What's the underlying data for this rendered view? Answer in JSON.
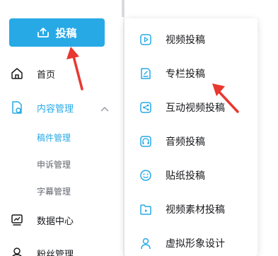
{
  "upload_button": {
    "label": "投稿",
    "icon": "upload-icon"
  },
  "sidebar": {
    "items": [
      {
        "label": "首页",
        "icon": "home-icon"
      },
      {
        "label": "内容管理",
        "icon": "content-manage-icon",
        "active": true
      },
      {
        "label": "数据中心",
        "icon": "chart-icon"
      },
      {
        "label": "粉丝管理",
        "icon": "user-icon"
      }
    ],
    "sub_items": [
      {
        "label": "稿件管理",
        "active": true
      },
      {
        "label": "申诉管理"
      },
      {
        "label": "字幕管理"
      }
    ]
  },
  "dropdown": {
    "items": [
      {
        "label": "视频投稿",
        "icon": "video-upload-icon"
      },
      {
        "label": "专栏投稿",
        "icon": "article-upload-icon"
      },
      {
        "label": "互动视频投稿",
        "icon": "interactive-video-icon"
      },
      {
        "label": "音频投稿",
        "icon": "audio-upload-icon"
      },
      {
        "label": "贴纸投稿",
        "icon": "sticker-upload-icon"
      },
      {
        "label": "视频素材投稿",
        "icon": "video-material-icon"
      },
      {
        "label": "虚拟形象设计",
        "icon": "avatar-design-icon"
      }
    ]
  },
  "colors": {
    "accent": "#27a9e6",
    "arrow": "#e8382f",
    "text": "#18191c",
    "muted": "#61666d"
  }
}
